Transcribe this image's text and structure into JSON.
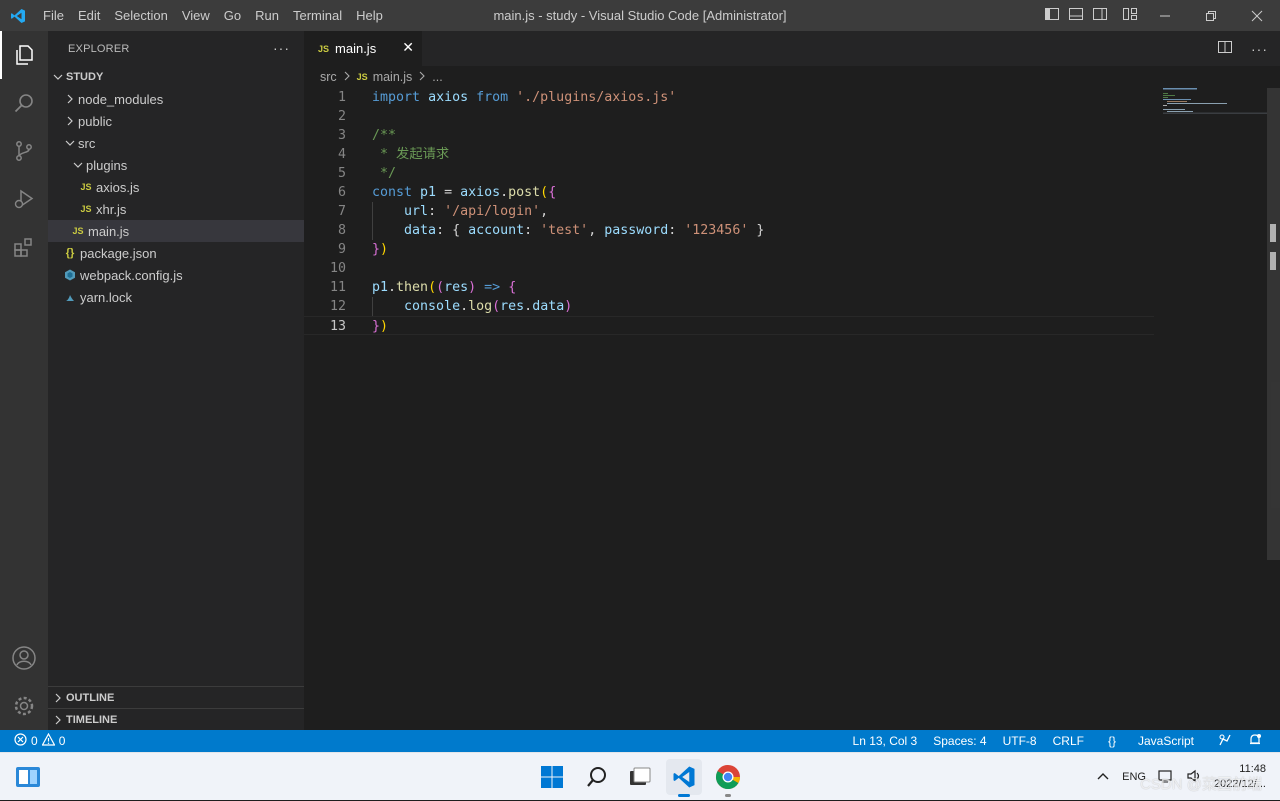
{
  "titlebar": {
    "menu": [
      "File",
      "Edit",
      "Selection",
      "View",
      "Go",
      "Run",
      "Terminal",
      "Help"
    ],
    "title": "main.js - study - Visual Studio Code [Administrator]"
  },
  "explorer": {
    "header": "EXPLORER",
    "more": "···",
    "root": "STUDY",
    "tree": [
      {
        "label": "node_modules",
        "type": "folder",
        "expanded": false,
        "depth": 0
      },
      {
        "label": "public",
        "type": "folder",
        "expanded": false,
        "depth": 0
      },
      {
        "label": "src",
        "type": "folder",
        "expanded": true,
        "depth": 0
      },
      {
        "label": "plugins",
        "type": "folder",
        "expanded": true,
        "depth": 1
      },
      {
        "label": "axios.js",
        "type": "js",
        "depth": 2
      },
      {
        "label": "xhr.js",
        "type": "js",
        "depth": 2
      },
      {
        "label": "main.js",
        "type": "js",
        "depth": 1,
        "selected": true
      },
      {
        "label": "package.json",
        "type": "json",
        "depth": 0
      },
      {
        "label": "webpack.config.js",
        "type": "webpack",
        "depth": 0
      },
      {
        "label": "yarn.lock",
        "type": "yarn",
        "depth": 0
      }
    ],
    "outline": "OUTLINE",
    "timeline": "TIMELINE"
  },
  "tab": {
    "icon_text": "JS",
    "label": "main.js",
    "close": "✕"
  },
  "breadcrumb": {
    "folder": "src",
    "icon_text": "JS",
    "file": "main.js",
    "ellipsis": "..."
  },
  "code": {
    "current_line": 13,
    "lines": [
      {
        "n": "1",
        "tokens": [
          [
            "k",
            "import"
          ],
          [
            "w",
            " "
          ],
          [
            "v",
            "axios"
          ],
          [
            "w",
            " "
          ],
          [
            "k",
            "from"
          ],
          [
            "w",
            " "
          ],
          [
            "s",
            "'./plugins/axios.js'"
          ]
        ]
      },
      {
        "n": "2",
        "tokens": []
      },
      {
        "n": "3",
        "tokens": [
          [
            "c",
            "/**"
          ]
        ]
      },
      {
        "n": "4",
        "tokens": [
          [
            "c",
            " * 发起请求"
          ]
        ]
      },
      {
        "n": "5",
        "tokens": [
          [
            "c",
            " */"
          ]
        ]
      },
      {
        "n": "6",
        "tokens": [
          [
            "k",
            "const"
          ],
          [
            "w",
            " "
          ],
          [
            "v",
            "p1"
          ],
          [
            "w",
            " = "
          ],
          [
            "v",
            "axios"
          ],
          [
            "w",
            "."
          ],
          [
            "f",
            "post"
          ],
          [
            "p1",
            "("
          ],
          [
            "p2",
            "{"
          ]
        ]
      },
      {
        "n": "7",
        "tokens": [
          [
            "w",
            "    "
          ],
          [
            "v",
            "url"
          ],
          [
            "w",
            ": "
          ],
          [
            "s",
            "'/api/login'"
          ],
          [
            "w",
            ","
          ]
        ]
      },
      {
        "n": "8",
        "tokens": [
          [
            "w",
            "    "
          ],
          [
            "v",
            "data"
          ],
          [
            "w",
            ": { "
          ],
          [
            "v",
            "account"
          ],
          [
            "w",
            ": "
          ],
          [
            "s",
            "'test'"
          ],
          [
            "w",
            ", "
          ],
          [
            "v",
            "password"
          ],
          [
            "w",
            ": "
          ],
          [
            "s",
            "'123456'"
          ],
          [
            "w",
            " }"
          ]
        ]
      },
      {
        "n": "9",
        "tokens": [
          [
            "p2",
            "}"
          ],
          [
            "p1",
            ")"
          ]
        ]
      },
      {
        "n": "10",
        "tokens": []
      },
      {
        "n": "11",
        "tokens": [
          [
            "v",
            "p1"
          ],
          [
            "w",
            "."
          ],
          [
            "f",
            "then"
          ],
          [
            "p1",
            "("
          ],
          [
            "p2",
            "("
          ],
          [
            "v",
            "res"
          ],
          [
            "p2",
            ")"
          ],
          [
            "w",
            " "
          ],
          [
            "k",
            "=>"
          ],
          [
            "w",
            " "
          ],
          [
            "p2",
            "{"
          ]
        ]
      },
      {
        "n": "12",
        "tokens": [
          [
            "w",
            "    "
          ],
          [
            "v",
            "console"
          ],
          [
            "w",
            "."
          ],
          [
            "f",
            "log"
          ],
          [
            "p2",
            "("
          ],
          [
            "v",
            "res"
          ],
          [
            "w",
            "."
          ],
          [
            "v",
            "data"
          ],
          [
            "p2",
            ")"
          ]
        ]
      },
      {
        "n": "13",
        "tokens": [
          [
            "p2",
            "}"
          ],
          [
            "p1",
            ")"
          ]
        ]
      }
    ]
  },
  "statusbar": {
    "errors": "0",
    "warnings": "0",
    "position": "Ln 13, Col 3",
    "spaces": "Spaces: 4",
    "encoding": "UTF-8",
    "eol": "CRLF",
    "language": "JavaScript",
    "language_icon": "{}"
  },
  "taskbar": {
    "tray_lang": "ENG",
    "time": "11:48",
    "date": "2022/12/...",
    "watermark": "CSDN @菜园前端"
  },
  "colors": {
    "accent": "#007acc",
    "activity_bg": "#333333",
    "sidebar_bg": "#252526",
    "editor_bg": "#1e1e1e",
    "titlebar_bg": "#3c3c3c",
    "js_icon": "#cbcb41"
  }
}
